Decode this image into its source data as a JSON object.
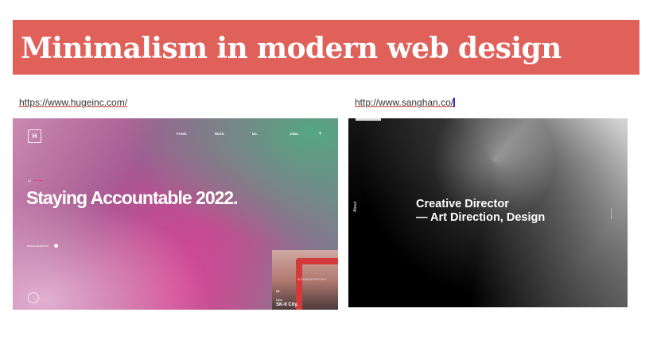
{
  "header": {
    "title": "Minimalism in modern web design",
    "bg_color": "#e0605a"
  },
  "links": {
    "left": "https://www.hugeinc.com/",
    "right": "http://www.sanghan.co/"
  },
  "left_shot": {
    "logo_letter": "H",
    "nav": [
      "Fresh.",
      "Work.",
      "Us.",
      "Jobs."
    ],
    "plus": "+",
    "index": "01.",
    "headline": "Staying Accountable 2022.",
    "announcement": "Announcement",
    "thumb": {
      "banner": "#CHANGEDESTINY",
      "index": "02.",
      "next": "Next",
      "title": "SK-II City."
    }
  },
  "right_shot": {
    "headline_line1": "Creative Director",
    "headline_line2": "— Art Direction, Design",
    "side_label": "About"
  }
}
